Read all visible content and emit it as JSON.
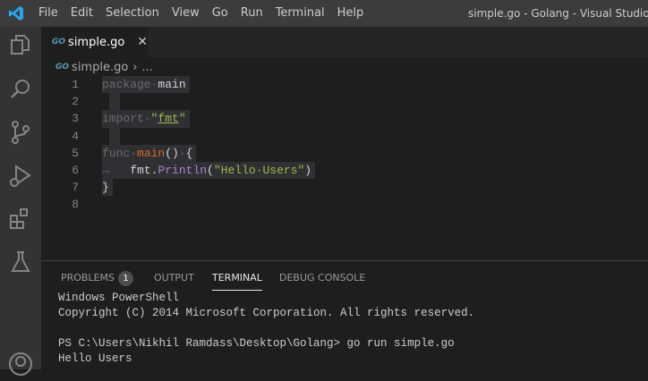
{
  "window": {
    "title": "simple.go - Golang - Visual Studio Code"
  },
  "menu": [
    "File",
    "Edit",
    "Selection",
    "View",
    "Go",
    "Run",
    "Terminal",
    "Help"
  ],
  "tab": {
    "icon_text": "GO",
    "label": "simple.go",
    "close": "✕"
  },
  "breadcrumb": {
    "icon_text": "GO",
    "file": "simple.go",
    "sep": "›",
    "rest": "..."
  },
  "code": {
    "line_numbers": [
      "1",
      "2",
      "3",
      "4",
      "5",
      "6",
      "7",
      "8"
    ]
  },
  "panel": {
    "tabs": [
      "PROBLEMS",
      "OUTPUT",
      "TERMINAL",
      "DEBUG CONSOLE"
    ],
    "problems_count": "1",
    "active": "TERMINAL"
  },
  "terminal": [
    "Windows PowerShell",
    "Copyright (C) 2014 Microsoft Corporation. All rights reserved.",
    "",
    "PS C:\\Users\\Nikhil Ramdass\\Desktop\\Golang> go run simple.go",
    "Hello Users"
  ],
  "colors": {
    "accent": "#007acc",
    "keyword": "#6b6b6b",
    "function": "#d9681e",
    "string": "#9cba4e"
  }
}
